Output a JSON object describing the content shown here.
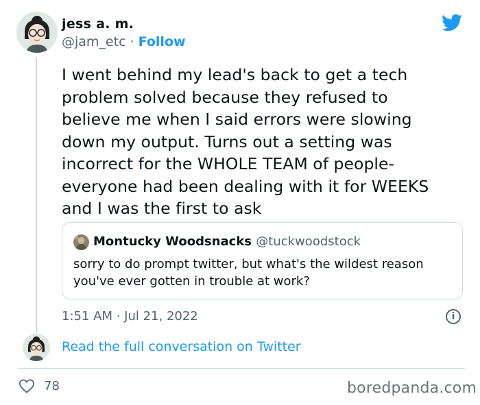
{
  "author": {
    "name": "jess a. m.",
    "handle": "@jam_etc",
    "separator": "·",
    "follow_label": "Follow",
    "avatar_icon": "cartoon-avatar-woman-glasses"
  },
  "platform_icon": "twitter-bird-icon",
  "tweet": {
    "text": "I went behind my lead's back to get a tech\nproblem solved because they refused to\nbelieve me when I said errors were slowing\ndown my output. Turns out a setting was\nincorrect for the WHOLE TEAM of people-\neveryone had been dealing with it for WEEKS\nand I was the first to ask",
    "timestamp": "1:51 AM · Jul 21, 2022"
  },
  "quoted_tweet": {
    "name": "Montucky Woodsnacks",
    "handle": "@tuckwoodstock",
    "text": "sorry to do prompt twitter, but what's the wildest reason\nyou've ever gotten in trouble at work?"
  },
  "read_full_label": "Read the full conversation on Twitter",
  "likes": "78",
  "watermark": "boredpanda.com",
  "colors": {
    "twitter_blue": "#1d9bf0",
    "secondary_text": "#536471",
    "border": "#cfd9de"
  }
}
